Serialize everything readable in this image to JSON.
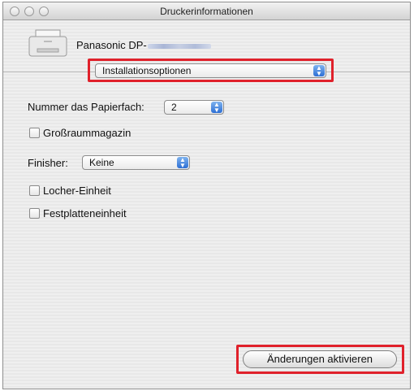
{
  "window": {
    "title": "Druckerinformationen"
  },
  "printer": {
    "name": "Panasonic DP-",
    "icon": "printer-icon"
  },
  "section_popup": {
    "value": "Installationsoptionen"
  },
  "options": {
    "tray_label": "Nummer das Papierfach:",
    "tray_value": "2",
    "grossraum_label": "Großraummagazin",
    "finisher_label": "Finisher:",
    "finisher_value": "Keine",
    "locher_label": "Locher-Einheit",
    "festplatte_label": "Festplatteneinheit"
  },
  "actions": {
    "apply_label": "Änderungen aktivieren"
  },
  "colors": {
    "highlight": "#e0212b",
    "popup_accent": "#2d6fd4"
  }
}
